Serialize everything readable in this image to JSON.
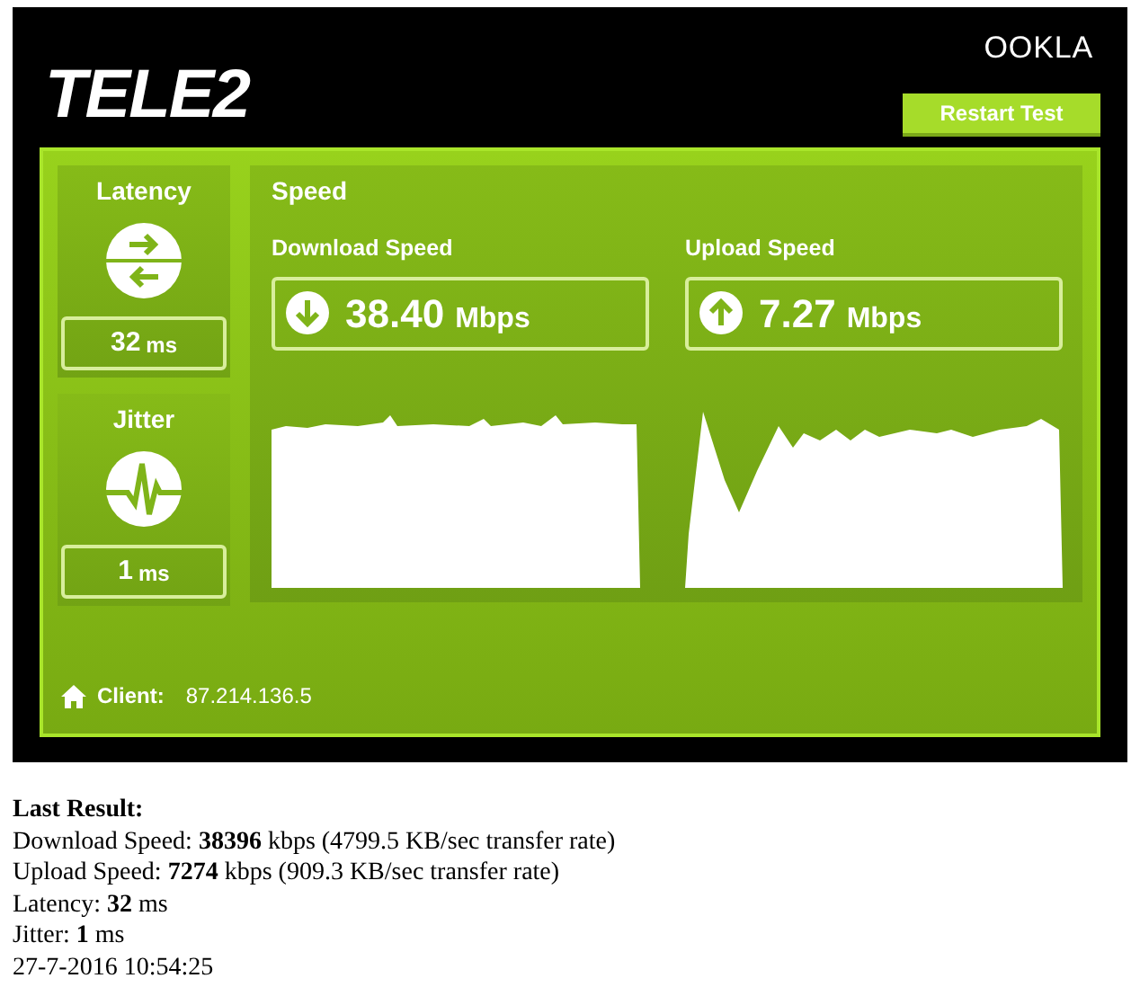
{
  "header": {
    "logo": "TELE2",
    "brand": "OOKLA",
    "restart_button": "Restart Test"
  },
  "metrics": [
    {
      "kind": "latency",
      "title": "Latency",
      "value": "32",
      "unit": "ms"
    },
    {
      "kind": "jitter",
      "title": "Jitter",
      "value": "1",
      "unit": "ms"
    }
  ],
  "speed": {
    "title": "Speed",
    "tests": [
      {
        "kind": "download",
        "label": "Download Speed",
        "value": "38.40",
        "unit": "Mbps"
      },
      {
        "kind": "upload",
        "label": "Upload Speed",
        "value": "7.27",
        "unit": "Mbps"
      }
    ]
  },
  "client": {
    "label": "Client:",
    "ip": "87.214.136.5"
  },
  "last_result": {
    "title": "Last Result:",
    "lines": [
      "Download Speed: **38396** kbps (4799.5 KB/sec transfer rate)",
      "Upload Speed: **7274** kbps (909.3 KB/sec transfer rate)",
      "Latency: **32** ms",
      "Jitter: **1** ms",
      "27-7-2016 10:54:25"
    ]
  }
}
